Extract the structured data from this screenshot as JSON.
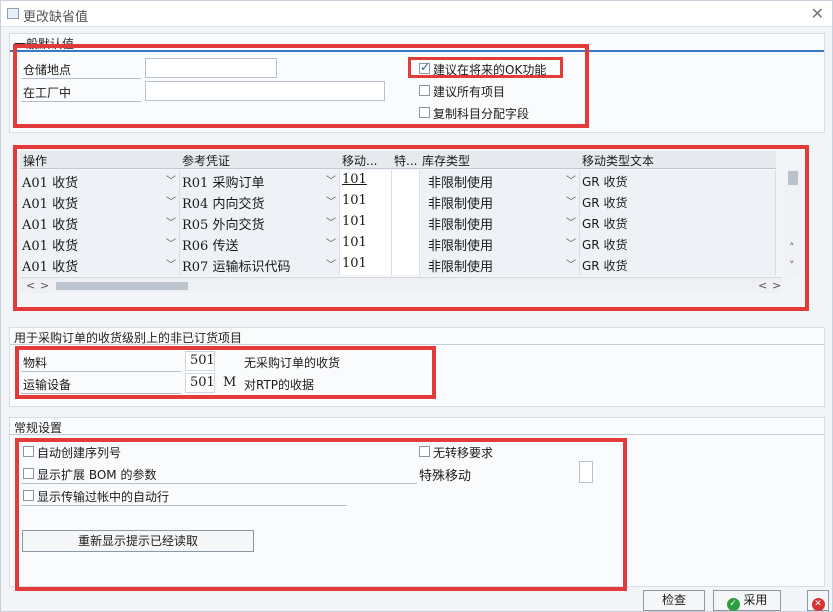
{
  "window": {
    "title": "更改缺省值"
  },
  "general": {
    "title": "一般默认值",
    "storage_location_label": "仓储地点",
    "in_plant_label": "在工厂中",
    "ok_suggest_label": "建议在将来的OK功能",
    "suggest_all_label": "建议所有项目",
    "copy_account_label": "复制科目分配字段"
  },
  "table": {
    "headers": [
      "操作",
      "参考凭证",
      "移动...",
      "特...",
      "库存类型",
      "移动类型文本"
    ],
    "rows": [
      {
        "action": "A01 收货",
        "ref": "R01 采购订单",
        "mvt": "101",
        "spec": "",
        "stock": "非限制使用",
        "text": "GR 收货"
      },
      {
        "action": "A01 收货",
        "ref": "R04 内向交货",
        "mvt": "101",
        "spec": "",
        "stock": "非限制使用",
        "text": "GR 收货"
      },
      {
        "action": "A01 收货",
        "ref": "R05 外向交货",
        "mvt": "101",
        "spec": "",
        "stock": "非限制使用",
        "text": "GR 收货"
      },
      {
        "action": "A01 收货",
        "ref": "R06 传送",
        "mvt": "101",
        "spec": "",
        "stock": "非限制使用",
        "text": "GR 收货"
      },
      {
        "action": "A01 收货",
        "ref": "R07 运输标识代码",
        "mvt": "101",
        "spec": "",
        "stock": "非限制使用",
        "text": "GR 收货"
      }
    ]
  },
  "nonorder": {
    "title": "用于采购订单的收货级别上的非已订货项目",
    "material_label": "物料",
    "material_value": "501",
    "material_text": "无采购订单的收货",
    "transport_label": "运输设备",
    "transport_value": "501",
    "transport_flag": "M",
    "transport_text": "对RTP的收据"
  },
  "settings": {
    "title": "常规设置",
    "auto_serial_label": "自动创建序列号",
    "bom_label": "显示扩展 BOM 的参数",
    "auto_line_label": "显示传输过帐中的自动行",
    "no_transfer_label": "无转移要求",
    "special_move_label": "特殊移动",
    "reread_label": "重新显示提示已经读取"
  },
  "footer": {
    "check_label": "检查",
    "apply_label": "采用"
  },
  "colors": {
    "highlight": "#e33a3a",
    "accent": "#3a78c5"
  }
}
